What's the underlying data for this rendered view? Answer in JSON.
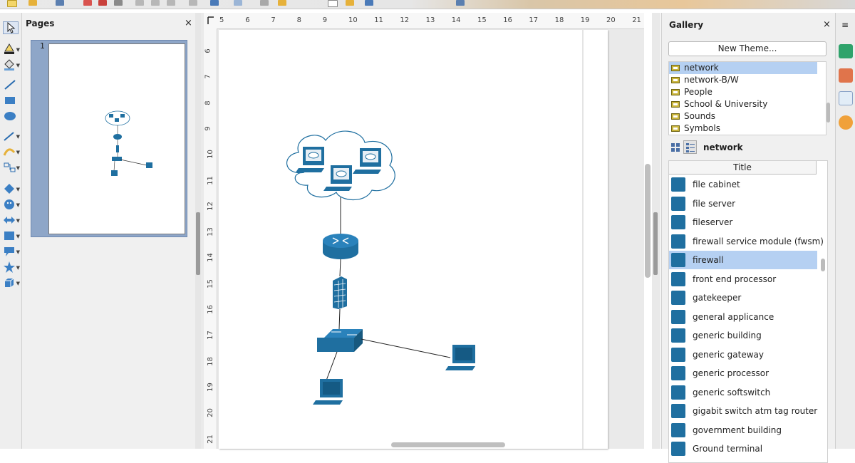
{
  "toolbar": {
    "icons": [
      "new-icon",
      "open-icon",
      "save-icon",
      "export-pdf-icon",
      "print-icon",
      "print-preview-icon",
      "cut-icon",
      "copy-icon",
      "paste-icon",
      "clone-icon",
      "undo-icon",
      "redo-icon",
      "grid-icon",
      "helplines-icon",
      "text-icon",
      "fontwork-icon",
      "transform-icon",
      "points-icon"
    ]
  },
  "pages_panel": {
    "title": "Pages",
    "close": "×",
    "thumbnail_number": "1"
  },
  "ruler": {
    "horizontal": [
      "5",
      "6",
      "7",
      "8",
      "9",
      "10",
      "11",
      "12",
      "13",
      "14",
      "15",
      "16",
      "17",
      "18",
      "19",
      "20",
      "21"
    ],
    "vertical": [
      "6",
      "7",
      "8",
      "9",
      "10",
      "11",
      "12",
      "13",
      "14",
      "15",
      "16",
      "17",
      "18",
      "19",
      "20",
      "21"
    ]
  },
  "drawing_tools": [
    "select-icon",
    "line-color-icon",
    "fill-color-icon",
    "line-icon",
    "rectangle-icon",
    "ellipse-icon",
    "lines-arrows-icon",
    "curve-icon",
    "connector-icon",
    "basic-shapes-icon",
    "symbol-shapes-icon",
    "block-arrows-icon",
    "flowchart-icon",
    "callout-icon",
    "stars-icon",
    "3d-objects-icon"
  ],
  "gallery": {
    "title": "Gallery",
    "close": "×",
    "new_theme_button": "New Theme...",
    "themes": [
      {
        "label": "network",
        "selected": true
      },
      {
        "label": "network-B/W",
        "selected": false
      },
      {
        "label": "People",
        "selected": false
      },
      {
        "label": "School & University",
        "selected": false
      },
      {
        "label": "Sounds",
        "selected": false
      },
      {
        "label": "Symbols",
        "selected": false
      }
    ],
    "current_theme": "network",
    "column_header": "Title",
    "items": [
      {
        "label": "file cabinet",
        "selected": false
      },
      {
        "label": "file server",
        "selected": false
      },
      {
        "label": "fileserver",
        "selected": false
      },
      {
        "label": "firewall service module (fwsm)",
        "selected": false
      },
      {
        "label": "firewall",
        "selected": true
      },
      {
        "label": "front end processor",
        "selected": false
      },
      {
        "label": "gatekeeper",
        "selected": false
      },
      {
        "label": "general applicance",
        "selected": false
      },
      {
        "label": "generic building",
        "selected": false
      },
      {
        "label": "generic gateway",
        "selected": false
      },
      {
        "label": "generic processor",
        "selected": false
      },
      {
        "label": "generic softswitch",
        "selected": false
      },
      {
        "label": "gigabit switch atm tag router",
        "selected": false
      },
      {
        "label": "government building",
        "selected": false
      },
      {
        "label": "Ground terminal",
        "selected": false
      }
    ]
  },
  "sidebar": {
    "icons": [
      "properties-icon",
      "styles-icon",
      "gallery-icon",
      "navigator-icon"
    ],
    "menu_glyph": "≡"
  },
  "colors": {
    "network_blue": "#1f6fa0",
    "selection": "#b5d0f2"
  }
}
